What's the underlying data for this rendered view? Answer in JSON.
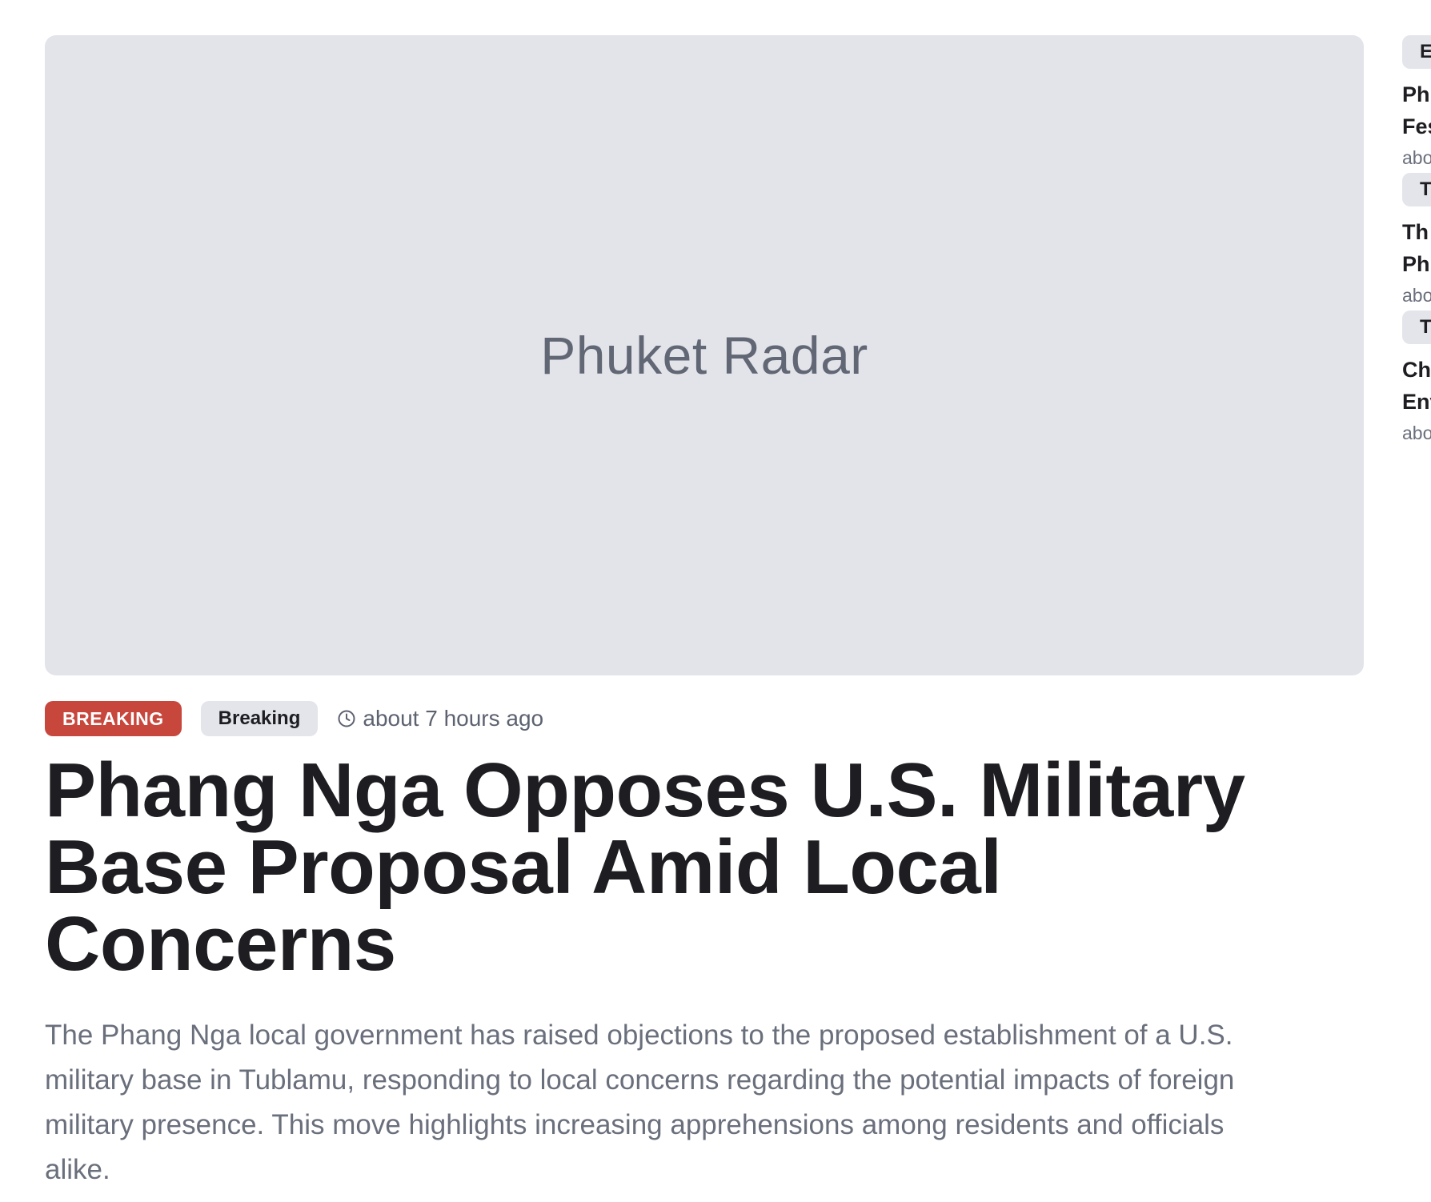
{
  "hero": {
    "placeholder_text": "Phuket Radar"
  },
  "article": {
    "breaking_label": "BREAKING",
    "category_label": "Breaking",
    "time_ago": "about 7 hours ago",
    "headline": "Phang Nga Opposes U.S. Military Base Proposal Amid Local Concerns",
    "summary": "The Phang Nga local government has raised objections to the proposed establishment of a U.S. military base in Tublamu, responding to local concerns regarding the potential impacts of foreign military presence. This move highlights increasing apprehensions among residents and officials alike."
  },
  "sidebar": {
    "items": [
      {
        "badge": "E",
        "title_line1": "Ph",
        "title_line2": "Fes",
        "time": "abo"
      },
      {
        "badge": "T",
        "title_line1": "Th",
        "title_line2": "Ph",
        "time": "abo"
      },
      {
        "badge": "T",
        "title_line1": "Ch",
        "title_line2": "Env",
        "time": "abo"
      }
    ]
  },
  "colors": {
    "breaking_badge": "#c8473c",
    "image_placeholder": "#e3e4e9",
    "category_badge": "#e3e5ea",
    "headline_text": "#1d1d22",
    "muted_text": "#6a6f7c"
  },
  "icons": {
    "time": "clock-icon"
  }
}
